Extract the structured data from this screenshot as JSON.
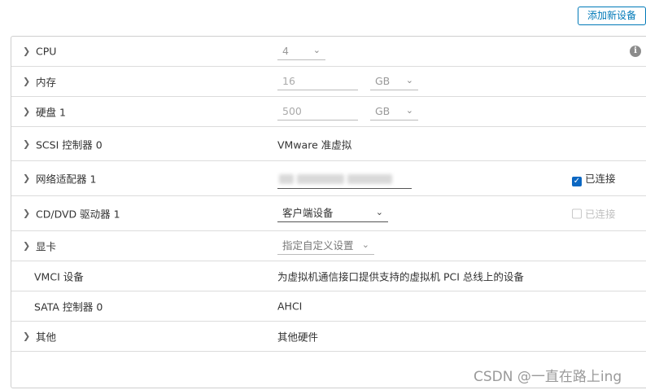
{
  "toolbar": {
    "add_device_label": "添加新设备"
  },
  "rows": {
    "cpu": {
      "label": "CPU",
      "value": "4"
    },
    "memory": {
      "label": "内存",
      "value": "16",
      "unit": "GB"
    },
    "disk": {
      "label": "硬盘 1",
      "value": "500",
      "unit": "GB"
    },
    "scsi": {
      "label": "SCSI 控制器 0",
      "value": "VMware 准虚拟"
    },
    "network": {
      "label": "网络适配器 1",
      "connected_label": "已连接",
      "connected": true
    },
    "cddvd": {
      "label": "CD/DVD 驱动器 1",
      "value": "客户端设备",
      "connected_label": "已连接",
      "connected": false
    },
    "video": {
      "label": "显卡",
      "value": "指定自定义设置"
    },
    "vmci": {
      "label": "VMCI 设备",
      "value": "为虚拟机通信接口提供支持的虚拟机 PCI 总线上的设备"
    },
    "sata": {
      "label": "SATA 控制器 0",
      "value": "AHCI"
    },
    "other": {
      "label": "其他",
      "value": "其他硬件"
    }
  },
  "watermark": "CSDN @一直在路上ing"
}
